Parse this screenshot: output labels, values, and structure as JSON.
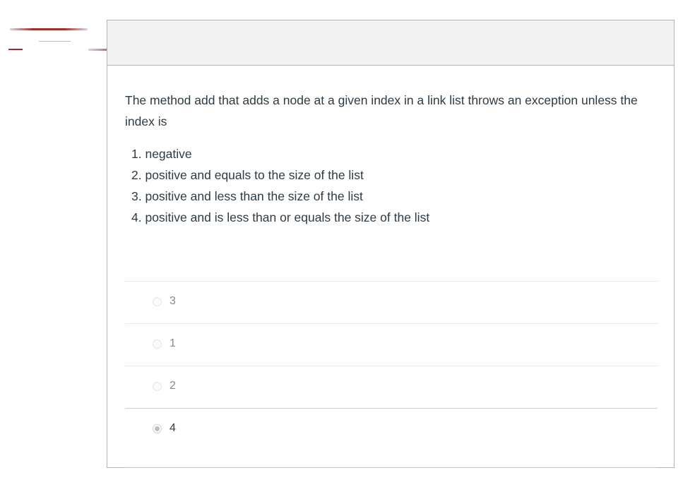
{
  "question": {
    "text": "The method add that adds a node at a given index in a link list throws an exception unless the index is",
    "options": [
      "1.  negative",
      "2. positive and equals to the size of the list",
      "3. positive and less than the size of the list",
      "4. positive and is less than or equals the size of the list"
    ]
  },
  "answers": [
    {
      "label": "3",
      "selected": false
    },
    {
      "label": "1",
      "selected": false
    },
    {
      "label": "2",
      "selected": false
    },
    {
      "label": "4",
      "selected": true
    }
  ],
  "colors": {
    "accent_artifact": "#a52a2a",
    "header_bg": "#f3f3f3",
    "border": "#b4b4b4",
    "text": "#2d3b45"
  }
}
